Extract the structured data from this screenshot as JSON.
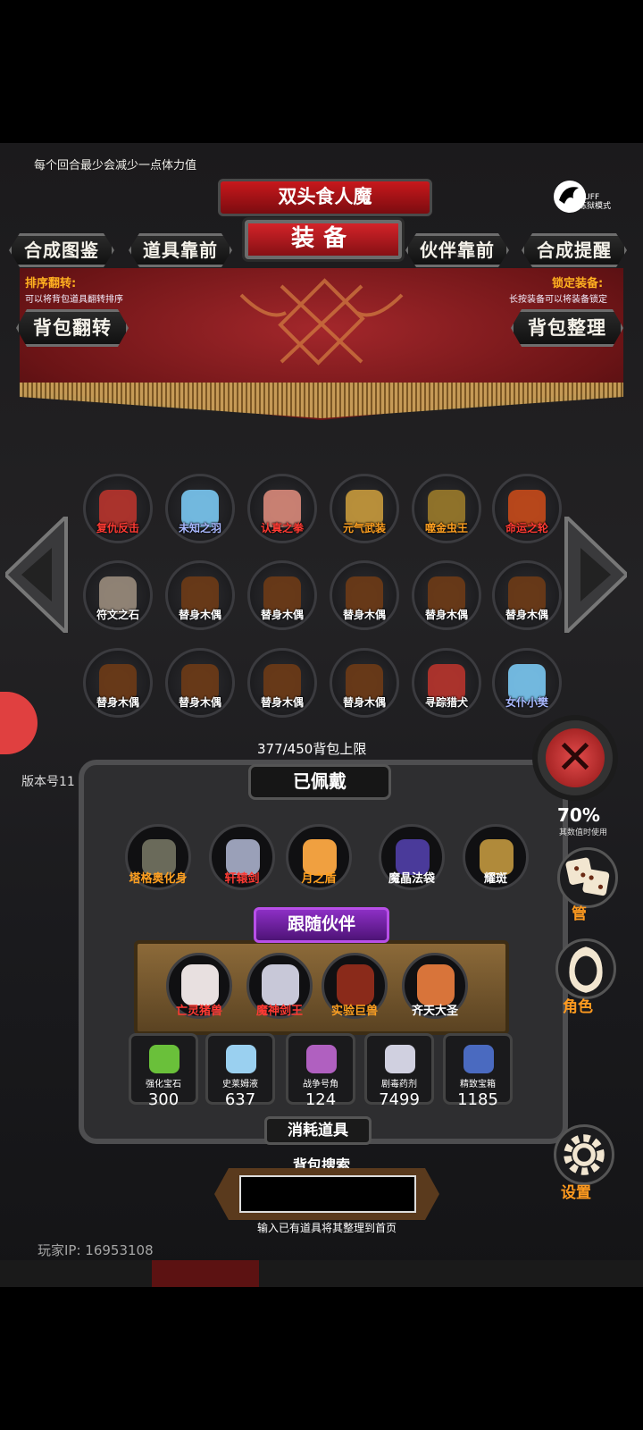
{
  "tip": "每个回合最少会减少一点体力值",
  "logo": {
    "line1": "BUFF",
    "line2": "炼狱模式"
  },
  "boss_banner": "双头食人魔",
  "title": "装备",
  "buttons": {
    "compose_book": "合成图鉴",
    "items_front": "道具靠前",
    "partner_front": "伙伴靠前",
    "compose_remind": "合成提醒",
    "bag_flip": "背包翻转",
    "bag_sort": "背包整理"
  },
  "sort_flip": {
    "title": "排序翻转:",
    "desc": "可以将背包道具翻转排序"
  },
  "lock_equip": {
    "title": "锁定装备:",
    "desc": "长按装备可以将装备锁定"
  },
  "inventory": [
    {
      "name": "复仇反击",
      "color": "red"
    },
    {
      "name": "未知之羽",
      "color": "blue"
    },
    {
      "name": "认真之拳",
      "color": "red"
    },
    {
      "name": "元气武装",
      "color": "orange"
    },
    {
      "name": "噬金虫王",
      "color": "orange"
    },
    {
      "name": "命运之轮",
      "color": "red"
    },
    {
      "name": "符文之石",
      "color": "white"
    },
    {
      "name": "替身木偶",
      "color": "white"
    },
    {
      "name": "替身木偶",
      "color": "white"
    },
    {
      "name": "替身木偶",
      "color": "white"
    },
    {
      "name": "替身木偶",
      "color": "white"
    },
    {
      "name": "替身木偶",
      "color": "white"
    },
    {
      "name": "替身木偶",
      "color": "white"
    },
    {
      "name": "替身木偶",
      "color": "white"
    },
    {
      "name": "替身木偶",
      "color": "white"
    },
    {
      "name": "替身木偶",
      "color": "white"
    },
    {
      "name": "寻踪猎犬",
      "color": "white"
    },
    {
      "name": "女仆小樊",
      "color": "blue"
    }
  ],
  "capacity_text": "377/450背包上限",
  "equipped_title": "已佩戴",
  "equipped": [
    {
      "name": "塔格奥化身",
      "color": "#ffa020"
    },
    {
      "name": "轩辕剑",
      "color": "#ff3a33"
    },
    {
      "name": "月之盾",
      "color": "#ffa020"
    },
    {
      "name": "魔晶法袋",
      "color": "#ffffff"
    },
    {
      "name": "耀斑",
      "color": "#ffffff"
    }
  ],
  "follow_title": "跟随伙伴",
  "partners": [
    {
      "name": "亡灵猪兽",
      "color": "#ff3a33"
    },
    {
      "name": "魔神剑王",
      "color": "#ff3a33"
    },
    {
      "name": "实验巨兽",
      "color": "#ffa020"
    },
    {
      "name": "齐天大圣",
      "color": "#ffffff"
    }
  ],
  "consumables": [
    {
      "name": "强化宝石",
      "count": "300"
    },
    {
      "name": "史莱姆液",
      "count": "637"
    },
    {
      "name": "战争号角",
      "count": "124"
    },
    {
      "name": "剧毒药剂",
      "count": "7499"
    },
    {
      "name": "精致宝箱",
      "count": "1185"
    }
  ],
  "consumables_title": "消耗道具",
  "search": {
    "title": "背包搜索",
    "hint": "输入已有道具将其整理到首页",
    "value": ""
  },
  "ratio": {
    "value": "70%",
    "desc": "其数值时使用"
  },
  "side": {
    "manage": "管",
    "role": "角色",
    "settings": "设置"
  },
  "version": "版本号11",
  "player_ip": "玩家IP: 16953108"
}
